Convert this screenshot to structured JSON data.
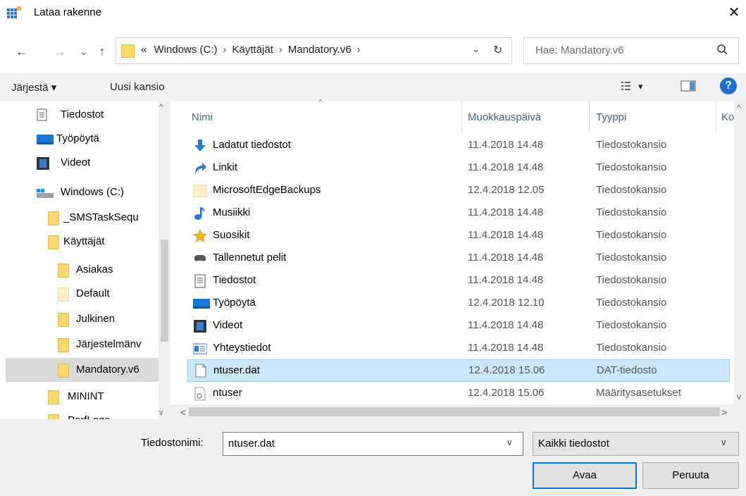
{
  "title": "Lataa rakenne",
  "close_glyph": "✕",
  "nav": {
    "back": "←",
    "forward": "→",
    "recent": "⌄",
    "up": "↑"
  },
  "address": {
    "overflow": "«",
    "crumbs": [
      "Windows (C:)",
      "Käyttäjät",
      "Mandatory.v6"
    ],
    "separator": "›",
    "dropdown": "⌄",
    "refresh": "↻"
  },
  "search": {
    "placeholder": "Hae: Mandatory.v6"
  },
  "toolbar": {
    "organize": "Järjestä ▾",
    "new_folder": "Uusi kansio",
    "view_dropdown": "▾",
    "help": "?"
  },
  "sidebar": {
    "items": [
      {
        "label": "Tiedostot",
        "icon": "documents-icon"
      },
      {
        "label": "Työpöytä",
        "icon": "desktop-icon"
      },
      {
        "label": "Videot",
        "icon": "videos-icon"
      },
      {
        "label": "Windows (C:)",
        "icon": "drive-icon"
      },
      {
        "label": "_SMSTaskSequ",
        "icon": "folder-icon"
      },
      {
        "label": "Käyttäjät",
        "icon": "folder-icon"
      },
      {
        "label": "Asiakas",
        "icon": "folder-icon"
      },
      {
        "label": "Default",
        "icon": "folder-icon"
      },
      {
        "label": "Julkinen",
        "icon": "folder-icon"
      },
      {
        "label": "Järjestelmänv",
        "icon": "folder-icon"
      },
      {
        "label": "Mandatory.v6",
        "icon": "folder-icon",
        "selected": true
      },
      {
        "label": "MININT",
        "icon": "folder-icon"
      },
      {
        "label": "PerfLogs",
        "icon": "folder-icon"
      }
    ]
  },
  "columns": {
    "name": "Nimi",
    "date": "Muokkauspäivä",
    "type": "Tyyppi",
    "size": "Koko"
  },
  "files": [
    {
      "name": "Ladatut tiedostot",
      "date": "11.4.2018 14.48",
      "type": "Tiedostokansio",
      "icon": "downloads-icon"
    },
    {
      "name": "Linkit",
      "date": "11.4.2018 14.48",
      "type": "Tiedostokansio",
      "icon": "links-icon"
    },
    {
      "name": "MicrosoftEdgeBackups",
      "date": "12.4.2018 12.05",
      "type": "Tiedostokansio",
      "icon": "folder-icon"
    },
    {
      "name": "Musiikki",
      "date": "11.4.2018 14.48",
      "type": "Tiedostokansio",
      "icon": "music-icon"
    },
    {
      "name": "Suosikit",
      "date": "11.4.2018 14.48",
      "type": "Tiedostokansio",
      "icon": "favorites-icon"
    },
    {
      "name": "Tallennetut pelit",
      "date": "11.4.2018 14.48",
      "type": "Tiedostokansio",
      "icon": "saved-games-icon"
    },
    {
      "name": "Tiedostot",
      "date": "11.4.2018 14.48",
      "type": "Tiedostokansio",
      "icon": "documents-icon"
    },
    {
      "name": "Työpöytä",
      "date": "12.4.2018 12.10",
      "type": "Tiedostokansio",
      "icon": "desktop-icon"
    },
    {
      "name": "Videot",
      "date": "11.4.2018 14.48",
      "type": "Tiedostokansio",
      "icon": "videos-icon"
    },
    {
      "name": "Yhteystiedot",
      "date": "11.4.2018 14.48",
      "type": "Tiedostokansio",
      "icon": "contacts-icon"
    },
    {
      "name": "ntuser.dat",
      "date": "12.4.2018 15.06",
      "type": "DAT-tiedosto",
      "icon": "file-icon",
      "selected": true
    },
    {
      "name": "ntuser",
      "date": "12.4.2018 15.06",
      "type": "Määritysasetukset",
      "icon": "settings-file-icon"
    }
  ],
  "filename": {
    "label": "Tiedostonimi:",
    "value": "ntuser.dat"
  },
  "filetype": {
    "value": "Kaikki tiedostot"
  },
  "buttons": {
    "open": "Avaa",
    "cancel": "Peruuta"
  },
  "colors": {
    "selection": "#cce8ff",
    "selection_border": "#99d1ff",
    "accent": "#0078d7",
    "folder": "#fdd96b"
  }
}
